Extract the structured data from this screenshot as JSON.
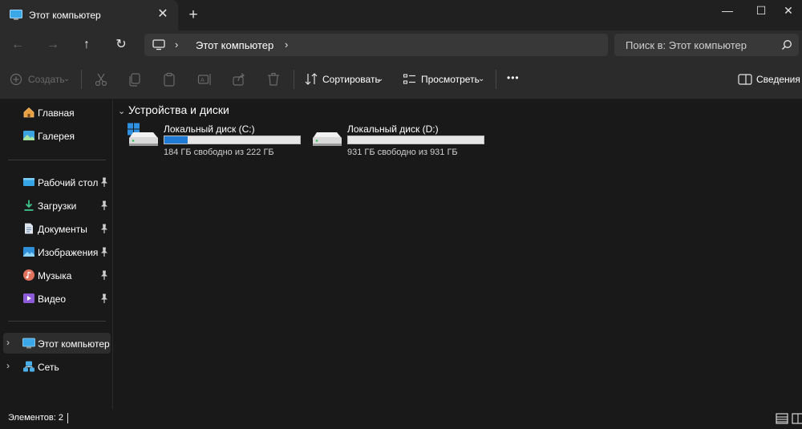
{
  "tab": {
    "title": "Этот компьютер",
    "icon": "monitor-icon"
  },
  "window_controls": {
    "minimize": "—",
    "maximize": "☐",
    "close": "✕",
    "new_tab": "+",
    "tab_close": "✕"
  },
  "address": {
    "breadcrumb": "Этот компьютер",
    "search_placeholder": "Поиск в: Этот компьютер"
  },
  "toolbar": {
    "create_label": "Создать",
    "sort_label": "Сортировать",
    "view_label": "Просмотреть",
    "more_label": "•••",
    "details_label": "Сведения"
  },
  "sidebar": {
    "items": [
      {
        "label": "Главная",
        "icon": "home-icon"
      },
      {
        "label": "Галерея",
        "icon": "gallery-icon"
      },
      {
        "label": "Рабочий стол",
        "icon": "desktop-icon"
      },
      {
        "label": "Загрузки",
        "icon": "downloads-icon"
      },
      {
        "label": "Документы",
        "icon": "documents-icon"
      },
      {
        "label": "Изображения",
        "icon": "pictures-icon"
      },
      {
        "label": "Музыка",
        "icon": "music-icon"
      },
      {
        "label": "Видео",
        "icon": "video-icon"
      },
      {
        "label": "Этот компьютер",
        "icon": "monitor-icon"
      },
      {
        "label": "Сеть",
        "icon": "network-icon"
      }
    ]
  },
  "content": {
    "group_title": "Устройства и диски",
    "drives": [
      {
        "name": "Локальный диск (C:)",
        "free_text": "184 ГБ свободно из 222 ГБ",
        "used_fraction": 0.17
      },
      {
        "name": "Локальный диск (D:)",
        "free_text": "931 ГБ свободно из 931 ГБ",
        "used_fraction": 0.0
      }
    ]
  },
  "status": {
    "items_count": "Элементов: 2"
  },
  "colors": {
    "accent": "#1f7ad4",
    "background": "#191919",
    "toolbar": "#2b2b2b"
  }
}
